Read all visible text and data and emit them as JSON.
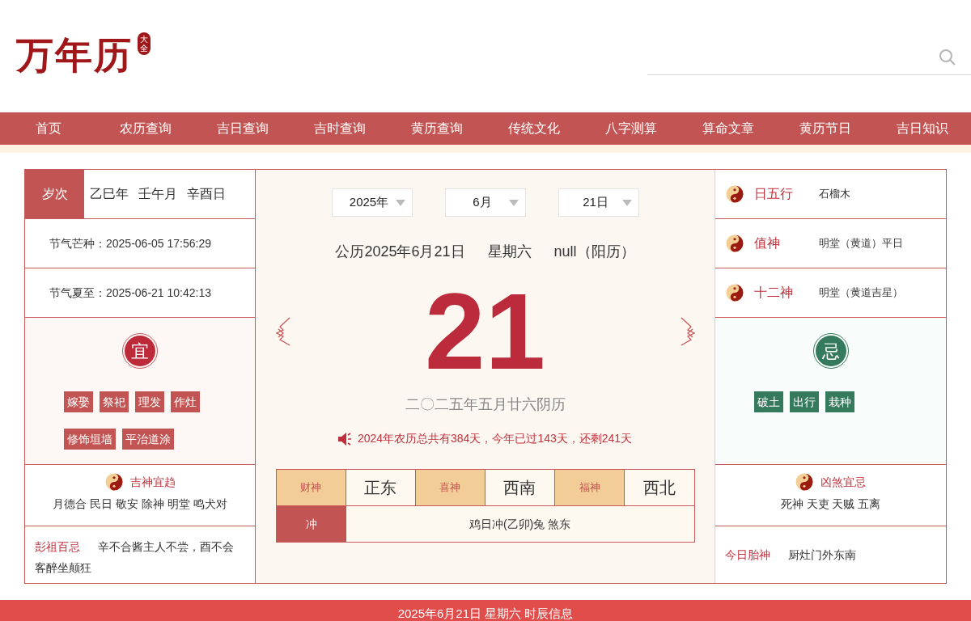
{
  "logo": {
    "title": "万年历",
    "badge": "大全"
  },
  "nav": [
    {
      "label": "首页"
    },
    {
      "label": "农历查询"
    },
    {
      "label": "吉日查询"
    },
    {
      "label": "吉时查询"
    },
    {
      "label": "黄历查询"
    },
    {
      "label": "传统文化"
    },
    {
      "label": "八字测算"
    },
    {
      "label": "算命文章"
    },
    {
      "label": "黄历节日"
    },
    {
      "label": "吉日知识"
    }
  ],
  "left": {
    "suici": {
      "label": "岁次",
      "values": [
        "乙巳年",
        "壬午月",
        "辛酉日"
      ]
    },
    "solar_terms": [
      "节气芒种：2025-06-05 17:56:29",
      "节气夏至：2025-06-21 10:42:13"
    ],
    "yi": {
      "title": "宜",
      "items": [
        "嫁娶",
        "祭祀",
        "理发",
        "作灶",
        "修饰垣墙",
        "平治道涂"
      ]
    },
    "jishen": {
      "title": "吉神宜趋",
      "text": "月德合 民日 敬安 除神 明堂 鸣犬对"
    },
    "pengzu": {
      "label": "彭祖百忌",
      "text": "辛不合酱主人不尝，酉不会客醉坐颠狂"
    }
  },
  "center": {
    "selectors": [
      {
        "value": "2025年"
      },
      {
        "value": "6月"
      },
      {
        "value": "21日"
      }
    ],
    "solar_date": [
      "公历2025年6月21日",
      "星期六",
      "null（阳历）"
    ],
    "day": "21",
    "lunar_date": "二〇二五年五月廿六阴历",
    "notice": "2024年农历总共有384天，今年已过143天，还剩241天",
    "gods": [
      {
        "label": "财神",
        "direction": "正东"
      },
      {
        "label": "喜神",
        "direction": "西南"
      },
      {
        "label": "福神",
        "direction": "西北"
      }
    ],
    "chong": {
      "label": "冲",
      "text": "鸡日冲(乙卯)兔 煞东"
    }
  },
  "right": {
    "rows": [
      {
        "label": "日五行",
        "value": "石榴木"
      },
      {
        "label": "值神",
        "value": "明堂（黄道）平日"
      },
      {
        "label": "十二神",
        "value": "明堂（黄道吉星）"
      }
    ],
    "ji": {
      "title": "忌",
      "items": [
        "破土",
        "出行",
        "栽种"
      ]
    },
    "xiongsha": {
      "title": "凶煞宜忌",
      "text": "死神 天吏 天贼 五离"
    },
    "taishen": {
      "label": "今日胎神",
      "value": "厨灶门外东南"
    }
  },
  "footer_banner": "2025年6月21日 星期六 时辰信息"
}
